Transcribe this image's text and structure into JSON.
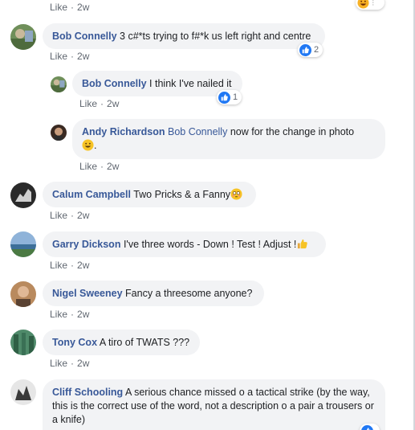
{
  "colors": {
    "name": "#385898",
    "bubble": "#f2f3f5",
    "meta": "#606770",
    "like_blue": "#2078f4"
  },
  "top_partial": {
    "like": "Like",
    "dot": "·",
    "time": "2w",
    "reaction_icon": "haha-icon"
  },
  "comments": [
    {
      "name": "Bob Connelly",
      "text": "3 c#*ts trying to f#*k us left right and centre",
      "like": "Like",
      "dot": "·",
      "time": "2w",
      "reaction_count": "2",
      "reaction_icon": "thumbs-up-icon"
    },
    {
      "name": "Bob Connelly",
      "text": "I think I've nailed it",
      "like": "Like",
      "dot": "·",
      "time": "2w",
      "reaction_count": "1",
      "reaction_icon": "thumbs-up-icon"
    },
    {
      "name": "Andy Richardson",
      "tag": "Bob Connelly",
      "text": "now for the change in photo",
      "text_end": ".",
      "emoji": "grinning-face-icon",
      "like": "Like",
      "dot": "·",
      "time": "2w"
    },
    {
      "name": "Calum Campbell",
      "text": "Two Pricks & a Fanny",
      "emoji": "flushed-face-icon",
      "like": "Like",
      "dot": "·",
      "time": "2w"
    },
    {
      "name": "Garry Dickson",
      "text": "I've three words - Down ! Test ! Adjust !",
      "emoji": "thumbs-up-emoji-icon",
      "like": "Like",
      "dot": "·",
      "time": "2w"
    },
    {
      "name": "Nigel Sweeney",
      "text": "Fancy a threesome anyone?",
      "like": "Like",
      "dot": "·",
      "time": "2w"
    },
    {
      "name": "Tony Cox",
      "text": "A tiro of TWATS ???",
      "like": "Like",
      "dot": "·",
      "time": "2w"
    },
    {
      "name": "Cliff Schooling",
      "text": "A serious chance missed o a tactical strike (by the way, this is the correct use of the word, not a description o a pair a trousers or a knife)",
      "reaction_icon": "thumbs-up-icon"
    }
  ]
}
